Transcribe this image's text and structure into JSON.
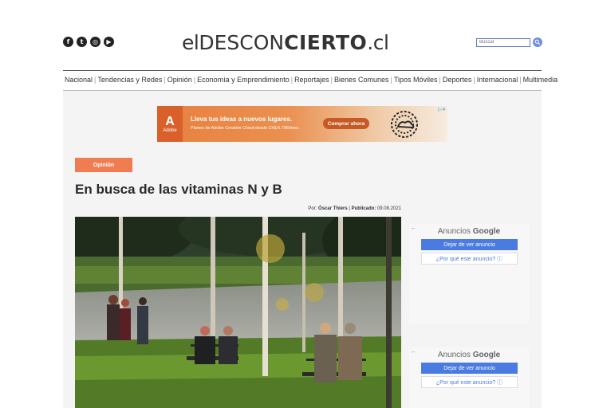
{
  "header": {
    "social_icons": [
      {
        "name": "facebook-icon",
        "glyph": "f"
      },
      {
        "name": "twitter-icon",
        "glyph": "t"
      },
      {
        "name": "instagram-icon",
        "glyph": "◎"
      },
      {
        "name": "youtube-icon",
        "glyph": "▶"
      }
    ],
    "logo": {
      "part1": "el",
      "part2": "DESCON",
      "part3": "CIERTO",
      "part4": ".cl"
    },
    "search_placeholder": "Buscar"
  },
  "nav": {
    "items": [
      "Nacional",
      "Tendencias y Redes",
      "Opinión",
      "Economía y Emprendimiento",
      "Reportajes",
      "Bienes Comunes",
      "Tipos Móviles",
      "Deportes",
      "Internacional",
      "Multimedia"
    ]
  },
  "ad_banner": {
    "brand": "Adobe",
    "headline": "Lleva tus ideas a nuevos lugares.",
    "subline": "Planes de Adobe Creative Cloud desde Ch$ 6.796/mes.",
    "cta": "Comprar ahora"
  },
  "article": {
    "category": "Opinión",
    "title": "En busca de las vitaminas N y B",
    "author_label": "Por:",
    "author": "Óscar Thiers",
    "published_label": "Publicado:",
    "date": "09.08.2021"
  },
  "google_ads": [
    {
      "brand_prefix": "Anuncios",
      "brand": "Google",
      "stop": "Dejar de ver anuncio",
      "why": "¿Por qué este anuncio? ⓘ"
    },
    {
      "brand_prefix": "Anuncios",
      "brand": "Google",
      "stop": "Dejar de ver anuncio",
      "why": "¿Por qué este anuncio? ⓘ"
    }
  ],
  "colors": {
    "accent": "#f07d52",
    "link_blue": "#4a7be0",
    "ad_orange": "#e8803f"
  }
}
